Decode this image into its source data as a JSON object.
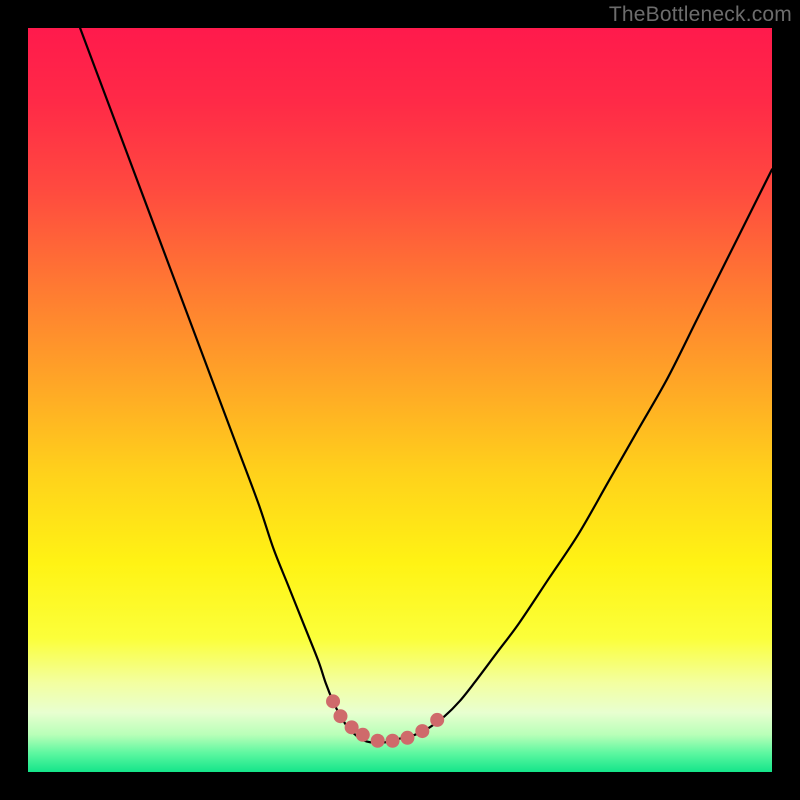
{
  "watermark": "TheBottleneck.com",
  "colors": {
    "curve": "#000000",
    "marker": "#cf6a6b",
    "frame": "#000000"
  },
  "gradient_stops": [
    {
      "offset": 0.0,
      "color": "#ff1a4c"
    },
    {
      "offset": 0.1,
      "color": "#ff2a47"
    },
    {
      "offset": 0.22,
      "color": "#ff4b3f"
    },
    {
      "offset": 0.35,
      "color": "#ff7a32"
    },
    {
      "offset": 0.48,
      "color": "#ffa726"
    },
    {
      "offset": 0.6,
      "color": "#ffd21b"
    },
    {
      "offset": 0.72,
      "color": "#fff314"
    },
    {
      "offset": 0.82,
      "color": "#fbff3a"
    },
    {
      "offset": 0.88,
      "color": "#f3ffa0"
    },
    {
      "offset": 0.92,
      "color": "#e8ffd0"
    },
    {
      "offset": 0.95,
      "color": "#b8ffb8"
    },
    {
      "offset": 0.975,
      "color": "#5cf7a0"
    },
    {
      "offset": 1.0,
      "color": "#14e58a"
    }
  ],
  "chart_data": {
    "type": "line",
    "title": "",
    "xlabel": "",
    "ylabel": "",
    "xlim": [
      0,
      100
    ],
    "ylim": [
      0,
      100
    ],
    "x": [
      7,
      10,
      13,
      16,
      19,
      22,
      25,
      28,
      31,
      33,
      35,
      37,
      39,
      40,
      41,
      42,
      43,
      44,
      45,
      46,
      47,
      48,
      49,
      50,
      52,
      54,
      56,
      58,
      60,
      63,
      66,
      70,
      74,
      78,
      82,
      86,
      90,
      94,
      98,
      100
    ],
    "values": [
      100,
      92,
      84,
      76,
      68,
      60,
      52,
      44,
      36,
      30,
      25,
      20,
      15,
      12,
      9.5,
      7.5,
      6,
      5,
      4.3,
      4,
      4,
      4,
      4.2,
      4.5,
      5,
      6,
      7.5,
      9.5,
      12,
      16,
      20,
      26,
      32,
      39,
      46,
      53,
      61,
      69,
      77,
      81
    ],
    "annotations": {
      "trough_markers_x": [
        41,
        42,
        43.5,
        45,
        47,
        49,
        51,
        53,
        55
      ],
      "trough_markers_y": [
        9.5,
        7.5,
        6,
        5,
        4.2,
        4.2,
        4.6,
        5.5,
        7
      ],
      "marker_radius_px": 7
    }
  }
}
